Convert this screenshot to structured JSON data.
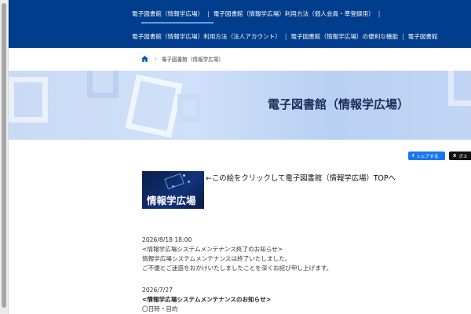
{
  "nav": {
    "row1": [
      "電子図書館（情報学広場）",
      "電子図書館（情報学広場）利用方法（個人会員・準登録用）"
    ],
    "row2": [
      "電子図書館（情報学広場）利用方法（法人アカウント）",
      "電子図書館（情報学広場）の便利な機能",
      "電子図書館"
    ],
    "separator": "|"
  },
  "breadcrumb": {
    "home_icon": "home-icon",
    "separator": "›",
    "current": "電子図書館（情報学広場）"
  },
  "hero": {
    "title": "電子図書館（情報学広場）"
  },
  "share": {
    "facebook_label": "シェアする",
    "facebook_icon": "f",
    "x_label": "ポス",
    "x_icon": "X"
  },
  "banner": {
    "label": "情報学広場"
  },
  "top_link": "←この絵をクリックして電子図書館（情報学広場）TOPへ",
  "news": [
    {
      "date": "2026/8/18 18:00",
      "title": "<情報学広場システムメンテナンス終了のお知らせ>",
      "lines": [
        "情報学広場システムメンテナンスは終了いたしました。",
        "ご不便とご迷惑をおかけいたしましたことを深くお詫び申し上げます。"
      ]
    },
    {
      "date": "2026/7/27",
      "title": "<情報学広場システムメンテナンスのお知らせ>",
      "lines": [
        "〇日時・目的"
      ]
    }
  ],
  "colors": {
    "nav_bg": "#003d8c",
    "nav_active_underline": "#5aa2ea",
    "facebook": "#1877f2",
    "x": "#111111"
  }
}
